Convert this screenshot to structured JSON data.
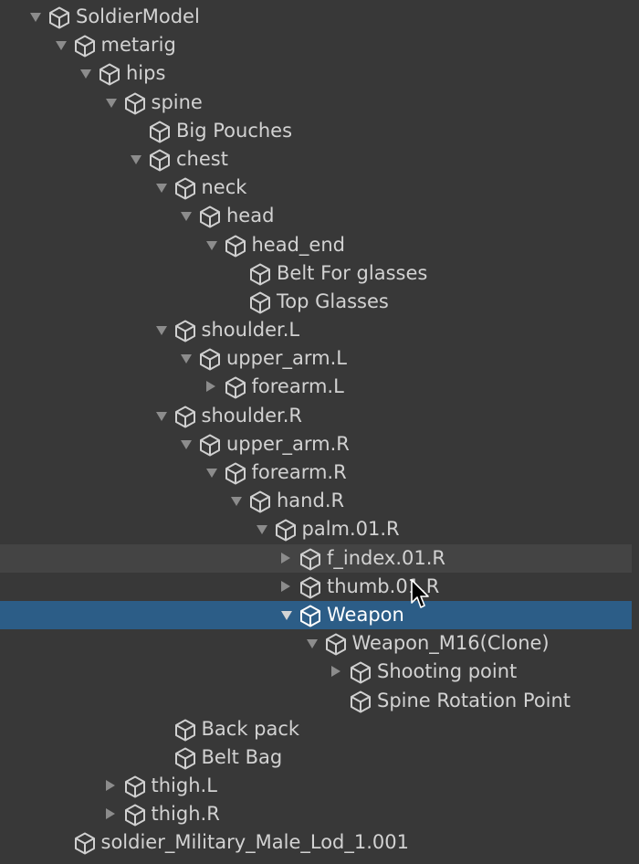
{
  "hierarchy": [
    {
      "label": "SoldierModel",
      "depth": 0,
      "toggle": "expanded",
      "state": ""
    },
    {
      "label": "metarig",
      "depth": 1,
      "toggle": "expanded",
      "state": ""
    },
    {
      "label": "hips",
      "depth": 2,
      "toggle": "expanded",
      "state": ""
    },
    {
      "label": "spine",
      "depth": 3,
      "toggle": "expanded",
      "state": ""
    },
    {
      "label": "Big Pouches",
      "depth": 4,
      "toggle": "none",
      "state": ""
    },
    {
      "label": "chest",
      "depth": 4,
      "toggle": "expanded",
      "state": ""
    },
    {
      "label": "neck",
      "depth": 5,
      "toggle": "expanded",
      "state": ""
    },
    {
      "label": "head",
      "depth": 6,
      "toggle": "expanded",
      "state": ""
    },
    {
      "label": "head_end",
      "depth": 7,
      "toggle": "expanded",
      "state": ""
    },
    {
      "label": "Belt For glasses",
      "depth": 8,
      "toggle": "none",
      "state": ""
    },
    {
      "label": "Top Glasses",
      "depth": 8,
      "toggle": "none",
      "state": ""
    },
    {
      "label": "shoulder.L",
      "depth": 5,
      "toggle": "expanded",
      "state": ""
    },
    {
      "label": "upper_arm.L",
      "depth": 6,
      "toggle": "expanded",
      "state": ""
    },
    {
      "label": "forearm.L",
      "depth": 7,
      "toggle": "collapsed",
      "state": ""
    },
    {
      "label": "shoulder.R",
      "depth": 5,
      "toggle": "expanded",
      "state": ""
    },
    {
      "label": "upper_arm.R",
      "depth": 6,
      "toggle": "expanded",
      "state": ""
    },
    {
      "label": "forearm.R",
      "depth": 7,
      "toggle": "expanded",
      "state": ""
    },
    {
      "label": "hand.R",
      "depth": 8,
      "toggle": "expanded",
      "state": ""
    },
    {
      "label": "palm.01.R",
      "depth": 9,
      "toggle": "expanded",
      "state": ""
    },
    {
      "label": "f_index.01.R",
      "depth": 10,
      "toggle": "collapsed",
      "state": "hover"
    },
    {
      "label": "thumb.01.R",
      "depth": 10,
      "toggle": "collapsed",
      "state": ""
    },
    {
      "label": "Weapon",
      "depth": 10,
      "toggle": "expanded",
      "state": "selected"
    },
    {
      "label": "Weapon_M16(Clone)",
      "depth": 11,
      "toggle": "expanded",
      "state": ""
    },
    {
      "label": "Shooting point",
      "depth": 12,
      "toggle": "collapsed",
      "state": ""
    },
    {
      "label": "Spine Rotation Point",
      "depth": 12,
      "toggle": "none",
      "state": ""
    },
    {
      "label": "Back pack",
      "depth": 5,
      "toggle": "none",
      "state": ""
    },
    {
      "label": "Belt Bag",
      "depth": 5,
      "toggle": "none",
      "state": ""
    },
    {
      "label": "thigh.L",
      "depth": 3,
      "toggle": "collapsed",
      "state": ""
    },
    {
      "label": "thigh.R",
      "depth": 3,
      "toggle": "collapsed",
      "state": ""
    },
    {
      "label": "soldier_Military_Male_Lod_1.001",
      "depth": 1,
      "toggle": "none",
      "state": ""
    }
  ],
  "icon": "gameobject-cube-icon",
  "colors": {
    "background": "#383838",
    "selection": "#2c5d87",
    "hover": "#444444",
    "text": "#d2d2d2",
    "arrow": "#8c8c8c"
  }
}
